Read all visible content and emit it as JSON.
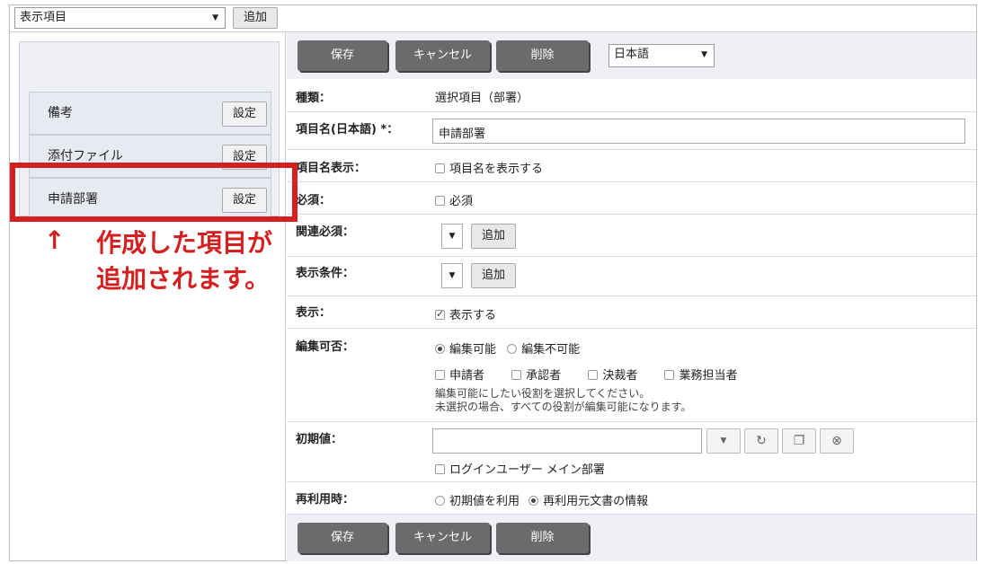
{
  "topbar": {
    "select_value": "表示項目",
    "add_label": "追加"
  },
  "left": {
    "items": [
      {
        "label": "備考",
        "button": "設定"
      },
      {
        "label": "添付ファイル",
        "button": "設定"
      },
      {
        "label": "申請部署",
        "button": "設定"
      }
    ],
    "annotation_arrow": "↑",
    "annotation_text": [
      "作成した項目が",
      "追加されます。"
    ]
  },
  "actions": {
    "save": "保存",
    "cancel": "キャンセル",
    "delete": "削除",
    "language": "日本語"
  },
  "form": {
    "type_label": "種類：",
    "type_value": "選択項目（部署）",
    "name_label": "項目名(日本語) *：",
    "name_value": "申請部署",
    "show_name_label": "項目名表示：",
    "show_name_option": "項目名を表示する",
    "required_label": "必須：",
    "required_option": "必須",
    "rel_required_label": "関連必須：",
    "rel_required_add": "追加",
    "cond_label": "表示条件：",
    "cond_add": "追加",
    "display_label": "表示：",
    "display_option": "表示する",
    "edit_label": "編集可否：",
    "edit_opt1": "編集可能",
    "edit_opt2": "編集不可能",
    "roles": [
      "申請者",
      "承認者",
      "決裁者",
      "業務担当者"
    ],
    "edit_note1": "編集可能にしたい役割を選択してください。",
    "edit_note2": "未選択の場合、すべての役割が編集可能になります。",
    "init_label": "初期値：",
    "init_option": "ログインユーザー メイン部署",
    "reuse_label": "再利用時：",
    "reuse_opt1": "初期値を利用",
    "reuse_opt2": "再利用元文書の情報"
  },
  "colors": {
    "accent": "#d42020",
    "dark_button": "#6b6b6b"
  }
}
